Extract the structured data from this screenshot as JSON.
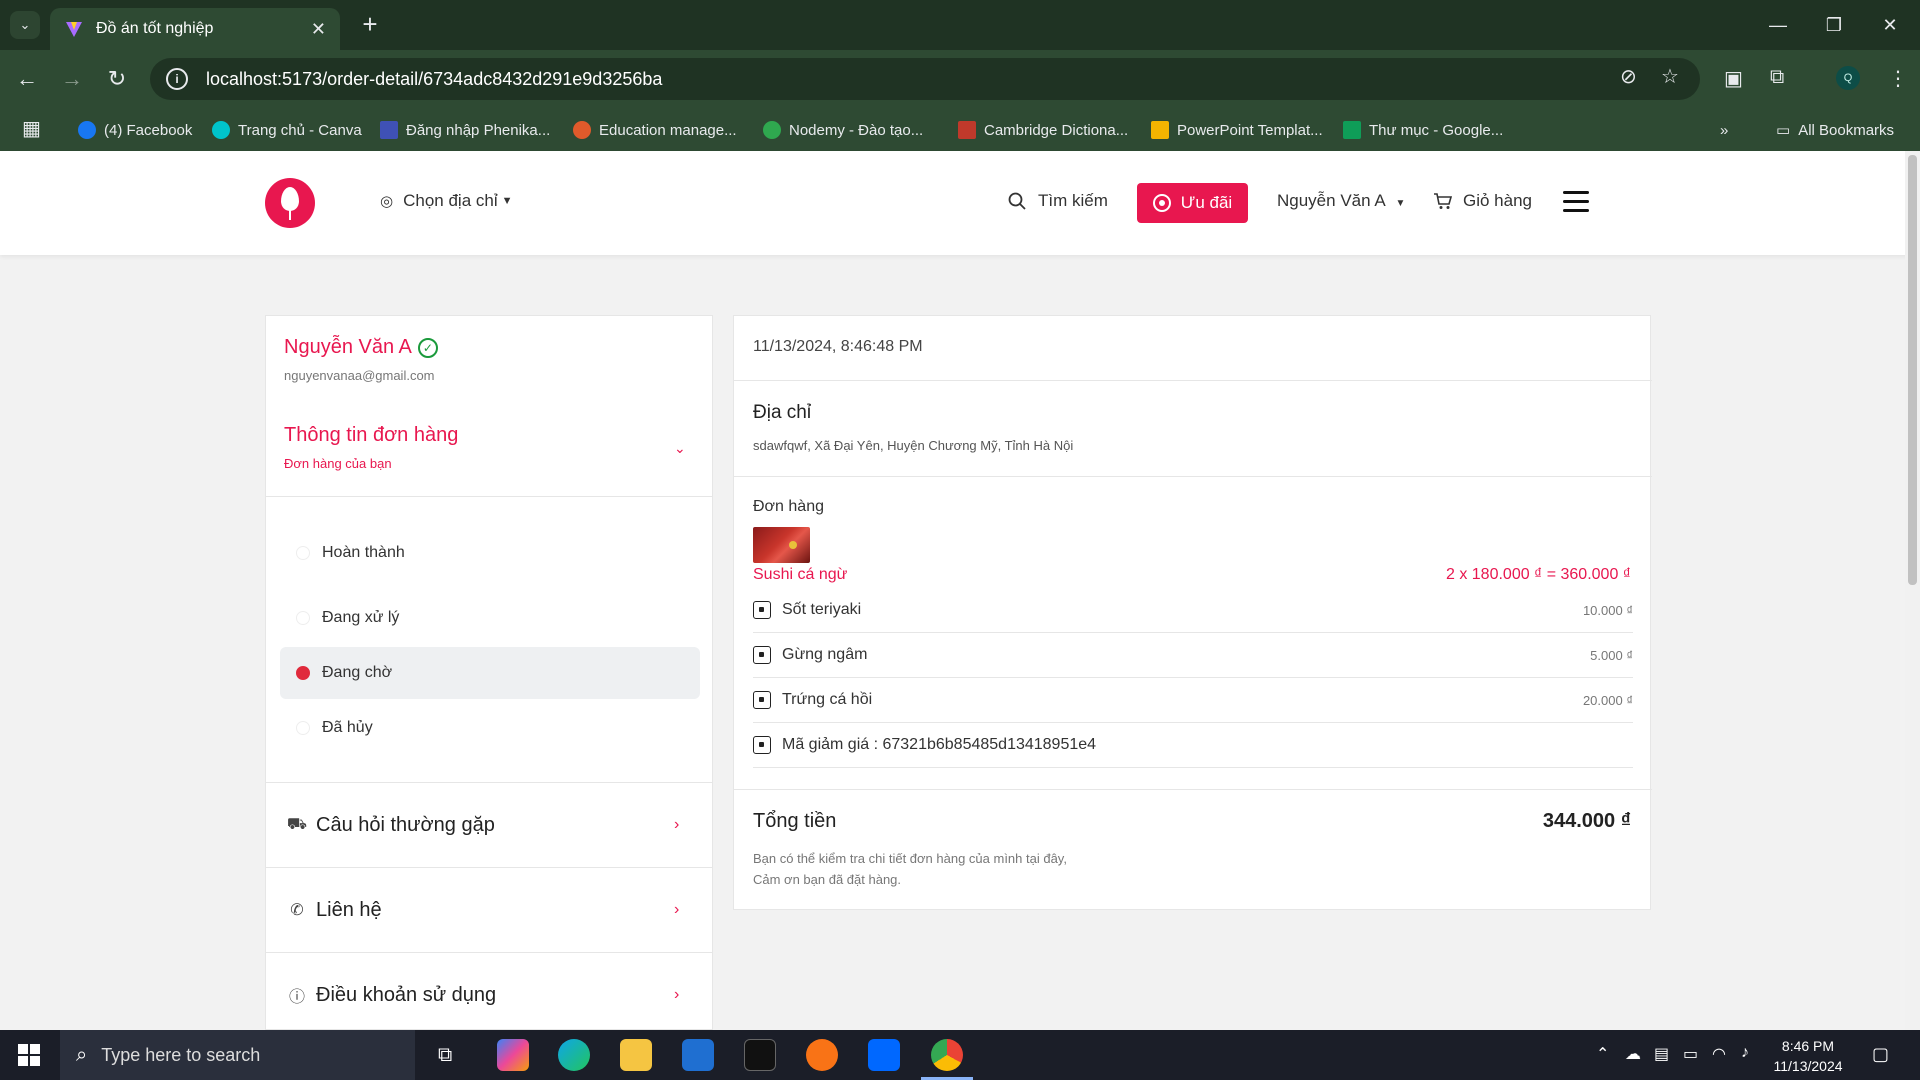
{
  "browser": {
    "tab_title": "Đồ án tốt nghiệp",
    "url": "localhost:5173/order-detail/6734adc8432d291e9d3256ba",
    "bookmarks": [
      {
        "label": "(4) Facebook",
        "color": "#1877f2"
      },
      {
        "label": "Trang chủ - Canva",
        "color": "#00c4cc"
      },
      {
        "label": "Đăng nhập Phenika...",
        "color": "#3f51b5"
      },
      {
        "label": "Education manage...",
        "color": "#e05a2b"
      },
      {
        "label": "Nodemy - Đào tạo...",
        "color": "#2fa84f"
      },
      {
        "label": "Cambridge Dictiona...",
        "color": "#c0392b"
      },
      {
        "label": "PowerPoint Templat...",
        "color": "#f4b400"
      },
      {
        "label": "Thư mục - Google...",
        "color": "#0f9d58"
      }
    ],
    "all_bookmarks": "All Bookmarks",
    "profile_initial": "Q"
  },
  "header": {
    "location": "Chọn địa chỉ",
    "search": "Tìm kiếm",
    "promo": "Ưu đãi",
    "user": "Nguyễn Văn A",
    "cart": "Giỏ hàng",
    "brand_color": "#e8174f"
  },
  "sidebar": {
    "name": "Nguyễn Văn A",
    "email": "nguyenvanaa@gmail.com",
    "order_title": "Thông tin đơn hàng",
    "order_subtitle": "Đơn hàng của bạn",
    "statuses": [
      {
        "label": "Hoàn thành",
        "active": false
      },
      {
        "label": "Đang xử lý",
        "active": false
      },
      {
        "label": "Đang chờ",
        "active": true
      },
      {
        "label": "Đã hủy",
        "active": false
      }
    ],
    "links": [
      {
        "label": "Câu hỏi thường gặp",
        "icon": "truck-icon"
      },
      {
        "label": "Liên hệ",
        "icon": "phone-icon"
      },
      {
        "label": "Điều khoản sử dụng",
        "icon": "info-icon"
      }
    ]
  },
  "order": {
    "datetime": "11/13/2024, 8:46:48 PM",
    "address_heading": "Địa chỉ",
    "address": "sdawfqwf, Xã Đại Yên, Huyện Chương Mỹ, Tỉnh Hà Nội",
    "items_heading": "Đơn hàng",
    "product_name": "Sushi cá ngừ",
    "product_price": "2 x 180.000 ₫ = 360.000 ₫",
    "options": [
      {
        "name": "Sốt teriyaki",
        "price": "10.000 ₫"
      },
      {
        "name": "Gừng ngâm",
        "price": "5.000 ₫"
      },
      {
        "name": "Trứng cá hồi",
        "price": "20.000 ₫"
      },
      {
        "name": "Mã giảm giá : 67321b6b85485d13418951e4",
        "price": ""
      }
    ],
    "total_heading": "Tổng tiền",
    "total": "344.000 ₫",
    "note_line1": "Bạn có thể kiểm tra chi tiết đơn hàng của mình tại đây,",
    "note_line2": "Cảm ơn bạn đã đặt hàng."
  },
  "taskbar": {
    "search_placeholder": "Type here to search",
    "time": "8:46 PM",
    "date": "11/13/2024"
  }
}
